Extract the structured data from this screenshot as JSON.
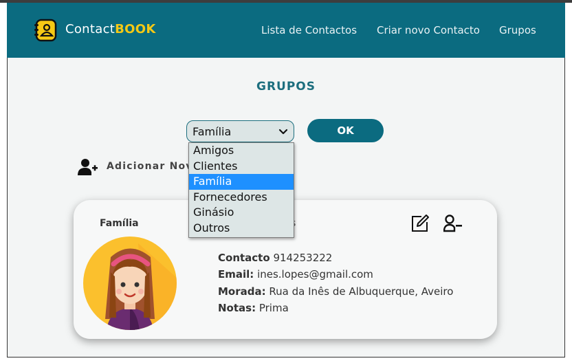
{
  "brand": {
    "name_part1": "Contact",
    "name_part2": "BOOK"
  },
  "nav": {
    "links": [
      {
        "label": "Lista de Contactos"
      },
      {
        "label": "Criar novo Contacto"
      },
      {
        "label": "Grupos"
      }
    ]
  },
  "page": {
    "title": "GRUPOS"
  },
  "group_select": {
    "selected": "Família",
    "options": [
      "Amigos",
      "Clientes",
      "Família",
      "Fornecedores",
      "Ginásio",
      "Outros"
    ],
    "highlighted_index": 2
  },
  "ok_button": {
    "label": "OK"
  },
  "add_contact": {
    "label": "Adicionar Nov"
  },
  "card": {
    "group": "Família",
    "partially_hidden": "s",
    "fields": [
      {
        "label": "Contacto",
        "value": "914253222"
      },
      {
        "label": "Email:",
        "value": "ines.lopes@gmail.com"
      },
      {
        "label": "Morada:",
        "value": "Rua da Inês de Albuquerque, Aveiro"
      },
      {
        "label": "Notas:",
        "value": "Prima"
      }
    ]
  },
  "colors": {
    "primary": "#0b6b80",
    "accent": "#f6c915",
    "highlight": "#1e90ff"
  }
}
